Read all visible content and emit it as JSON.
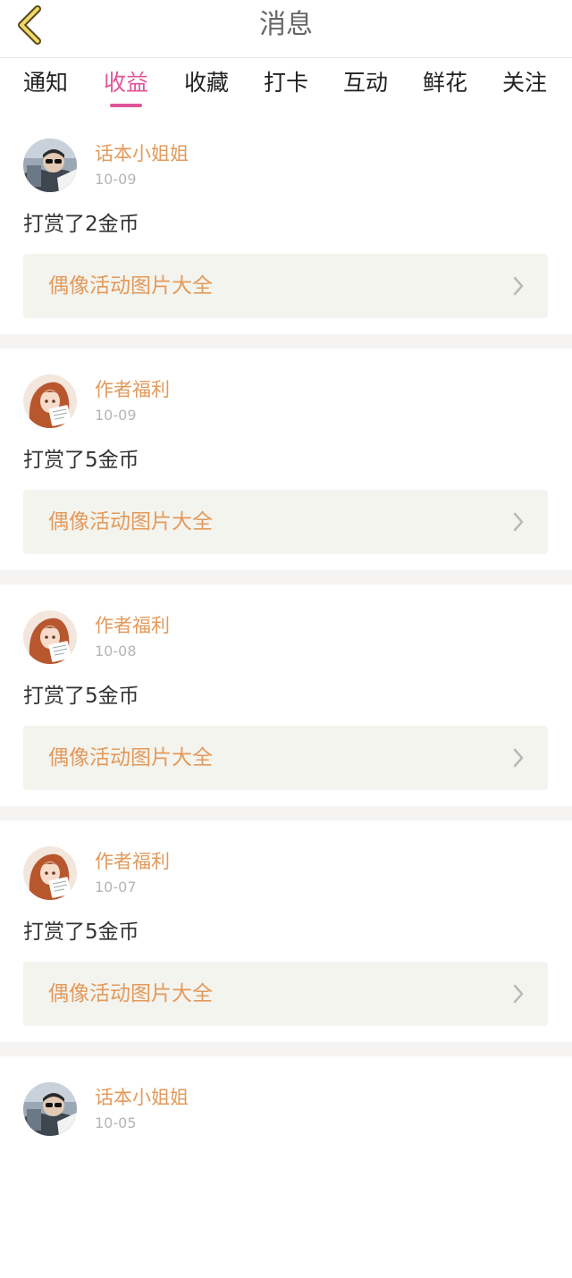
{
  "header": {
    "title": "消息",
    "back_icon": "chevron-left-icon"
  },
  "colors": {
    "accent": "#e0559a",
    "name": "#e39a5b",
    "link_bg": "#f4f4ef",
    "separator": "#f6f3f3"
  },
  "tabs": [
    {
      "label": "通知"
    },
    {
      "label": "收益",
      "active": true
    },
    {
      "label": "收藏"
    },
    {
      "label": "打卡"
    },
    {
      "label": "互动"
    },
    {
      "label": "鲜花"
    },
    {
      "label": "关注"
    }
  ],
  "messages": [
    {
      "user": "话本小姐姐",
      "date": "10-09",
      "text": "打赏了2金币",
      "link": "偶像活动图片大全",
      "avatar": "man-sunglasses-avatar"
    },
    {
      "user": "作者福利",
      "date": "10-09",
      "text": "打赏了5金币",
      "link": "偶像活动图片大全",
      "avatar": "anime-girl-avatar"
    },
    {
      "user": "作者福利",
      "date": "10-08",
      "text": "打赏了5金币",
      "link": "偶像活动图片大全",
      "avatar": "anime-girl-avatar"
    },
    {
      "user": "作者福利",
      "date": "10-07",
      "text": "打赏了5金币",
      "link": "偶像活动图片大全",
      "avatar": "anime-girl-avatar"
    },
    {
      "user": "话本小姐姐",
      "date": "10-05",
      "avatar": "man-sunglasses-avatar"
    }
  ]
}
